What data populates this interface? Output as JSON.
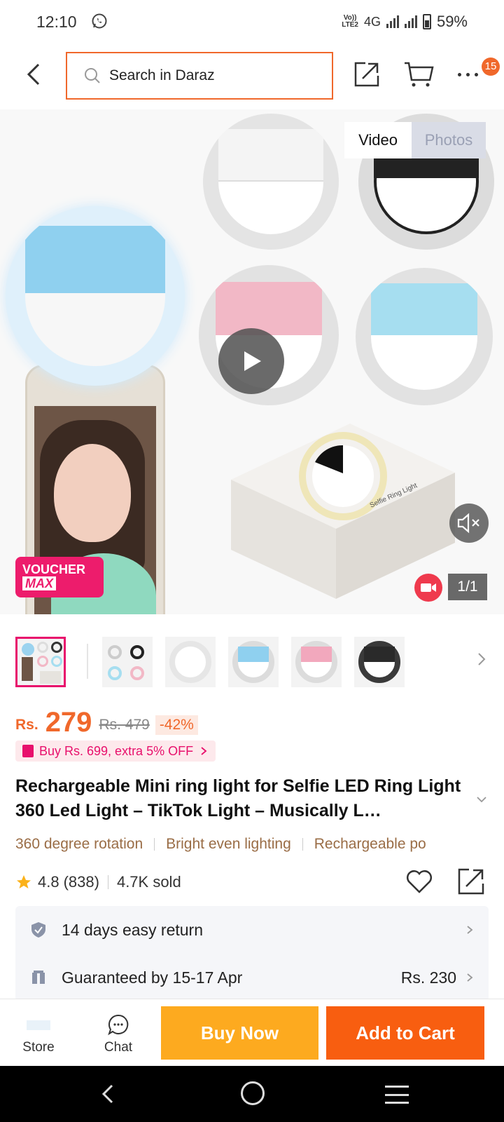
{
  "status_bar": {
    "time": "12:10",
    "network_top": "Vo))",
    "network_bottom": "LTE2",
    "network_type": "4G",
    "battery": "59%"
  },
  "header": {
    "search_placeholder": "Search in Daraz",
    "cart_badge": "15"
  },
  "gallery": {
    "toggle_video": "Video",
    "toggle_photos": "Photos",
    "voucher_line1": "VOUCHER",
    "voucher_line2": "MAX",
    "page_counter": "1/1",
    "box_text": "Selfie Ring Light",
    "thumbnails_count": 7
  },
  "price": {
    "currency": "Rs.",
    "current": "279",
    "original": "Rs. 479",
    "discount": "-42%",
    "promo": "Buy Rs. 699, extra 5% OFF"
  },
  "product": {
    "title": "Rechargeable Mini ring light for Selfie LED Ring Light 360 Led Light – TikTok Light – Musically L…",
    "features": [
      "360 degree rotation",
      "Bright even lighting",
      "Rechargeable po"
    ],
    "rating": "4.8",
    "reviews": "(838)",
    "sold": "4.7K sold"
  },
  "services": {
    "return": "14 days easy return",
    "delivery": "Guaranteed by 15-17 Apr",
    "delivery_fee": "Rs. 230"
  },
  "action_bar": {
    "store": "Store",
    "chat": "Chat",
    "buy_now": "Buy Now",
    "add_to_cart": "Add to Cart"
  },
  "colors": {
    "accent_orange": "#f0682b",
    "buy_now": "#fdaa1f",
    "add_to_cart": "#f85e10",
    "voucher": "#ed1c6c"
  }
}
